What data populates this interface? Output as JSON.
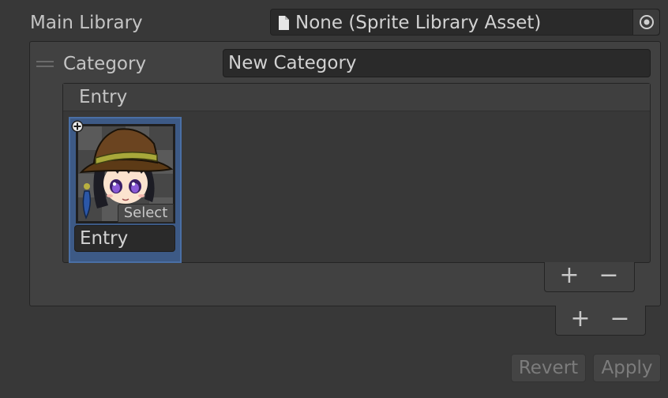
{
  "main_library": {
    "label": "Main Library",
    "value": "None (Sprite Library Asset)",
    "icon": "file-icon",
    "picker_icon": "object-picker-icon"
  },
  "category": {
    "label": "Category",
    "value": "New Category",
    "handle_icon": "drag-handle-icon"
  },
  "entry_list": {
    "header": "Entry",
    "entries": [
      {
        "name": "Entry",
        "select_label": "Select",
        "selected": true,
        "add_icon": "add-circle-icon",
        "sprite": "witch-character-sprite"
      }
    ],
    "footer": {
      "add_label": "+",
      "remove_label": "−"
    }
  },
  "category_footer": {
    "add_label": "+",
    "remove_label": "−"
  },
  "actions": {
    "revert_label": "Revert",
    "apply_label": "Apply"
  },
  "colors": {
    "background": "#383838",
    "panel": "#414141",
    "field": "#2a2a2a",
    "selection": "#3d5a86",
    "text": "#c4c4c4",
    "disabled_text": "#7c7c7c"
  }
}
